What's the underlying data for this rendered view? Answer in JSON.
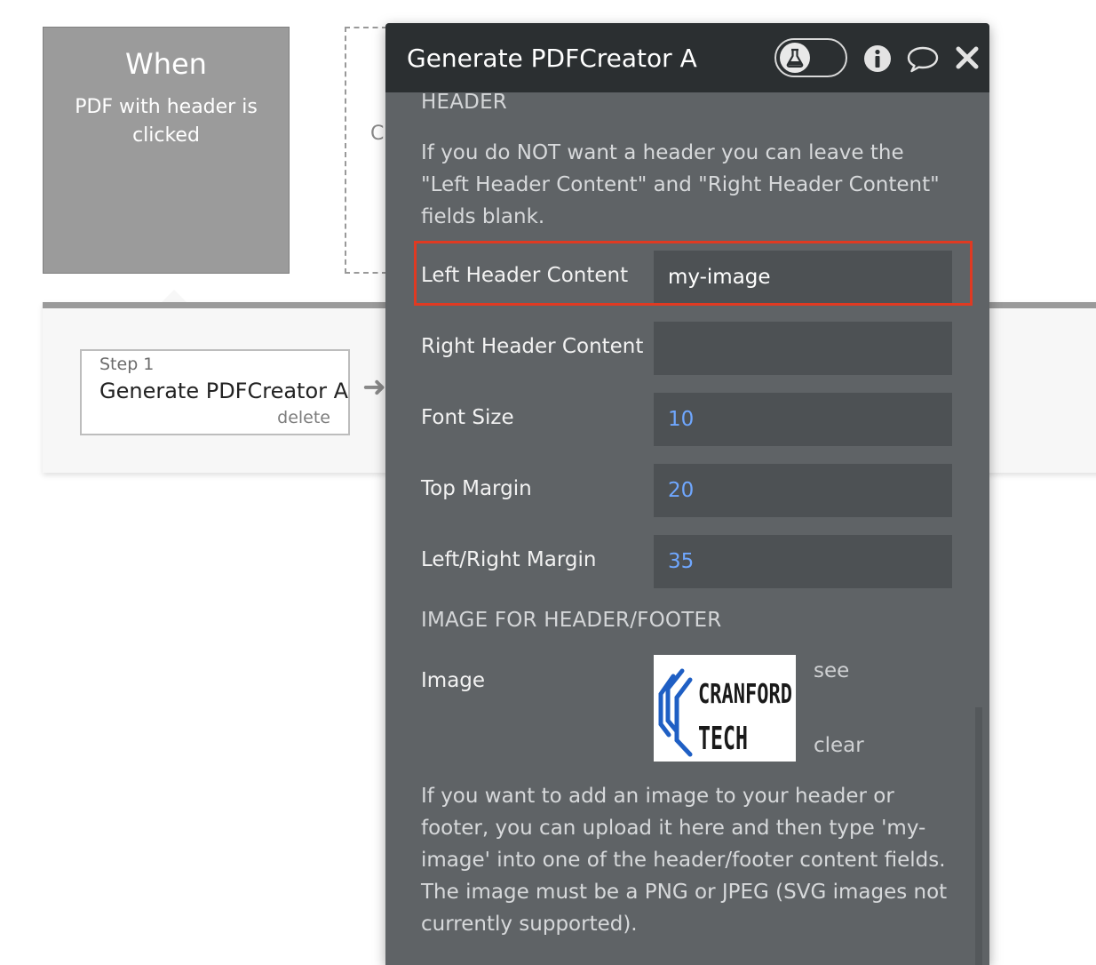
{
  "event": {
    "when_label": "When",
    "description": "PDF with header is clicked"
  },
  "ghost_card": {
    "letter": "C"
  },
  "step": {
    "number_label": "Step 1",
    "title": "Generate PDFCreator A",
    "delete_label": "delete"
  },
  "editor": {
    "title": "Generate PDFCreator A",
    "icons": {
      "test": "flask-icon",
      "info": "info-icon",
      "comment": "comment-icon",
      "close": "close-icon"
    },
    "header_section": {
      "label": "HEADER",
      "help": "If you do NOT want a header you can leave the \"Left Header Content\" and \"Right Header Content\" fields blank."
    },
    "fields": [
      {
        "label": "Left Header Content",
        "value": "my-image"
      },
      {
        "label": "Right Header Content",
        "value": ""
      },
      {
        "label": "Font Size",
        "value": "10"
      },
      {
        "label": "Top Margin",
        "value": "20"
      },
      {
        "label": "Left/Right Margin",
        "value": "35"
      }
    ],
    "image_section": {
      "label": "IMAGE FOR HEADER/FOOTER",
      "field_label": "Image",
      "image_text_line1": "CRANFORD",
      "image_text_line2": "TECH",
      "see_label": "see",
      "clear_label": "clear",
      "help": "If you want to add an image to your header or footer, you can upload it here and then type 'my-image' into one of the header/footer content fields. The image must be a PNG or JPEG (SVG images not currently supported)."
    }
  },
  "colors": {
    "highlight": "#e03a22",
    "number_value": "#6fa7ff",
    "panel": "#5f6366",
    "panel_header": "#2b2f31"
  }
}
